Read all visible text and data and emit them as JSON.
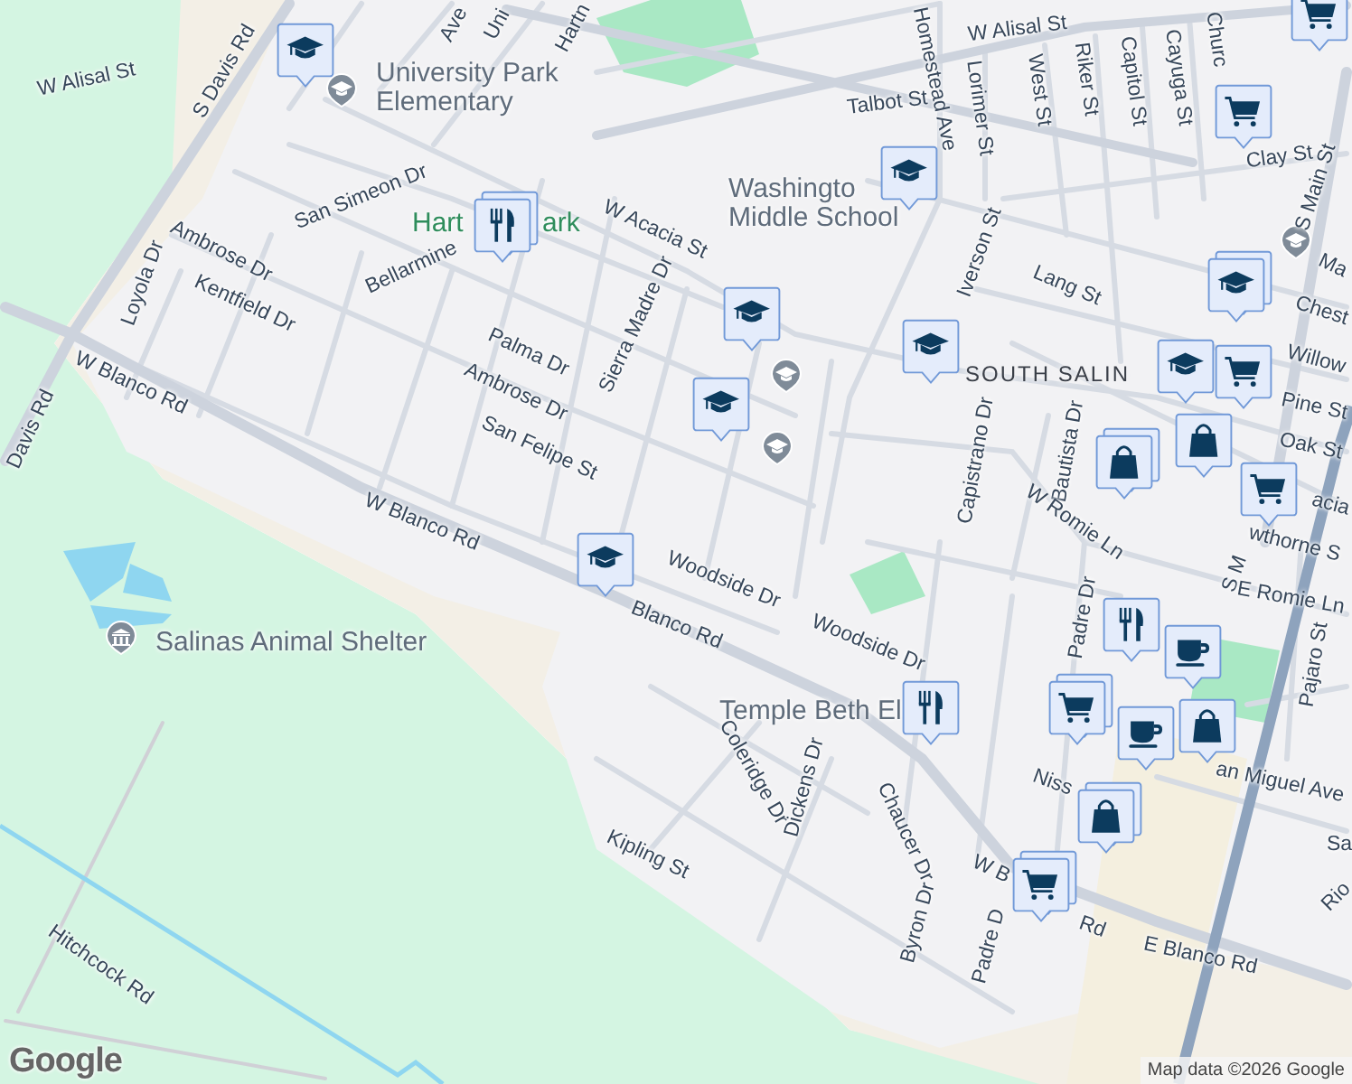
{
  "map": {
    "places": [
      {
        "kind": "school",
        "lines": [
          "University Park",
          "Elementary"
        ]
      },
      {
        "kind": "park",
        "lines": [
          "Hart"
        ]
      },
      {
        "kind": "park",
        "lines": [
          "ark"
        ]
      },
      {
        "kind": "school",
        "lines": [
          "Washingto",
          "Middle School"
        ]
      },
      {
        "kind": "district",
        "lines": [
          "SOUTH SALIN"
        ]
      },
      {
        "kind": "shelter",
        "lines": [
          "Salinas Animal Shelter"
        ]
      },
      {
        "kind": "worship",
        "lines": [
          "Temple Beth El"
        ]
      }
    ],
    "streets": [
      {
        "name": "Ave"
      },
      {
        "name": "Uni"
      },
      {
        "name": "Hartn"
      },
      {
        "name": "S Davis Rd"
      },
      {
        "name": "Davis Rd"
      },
      {
        "name": "W Blanco Rd"
      },
      {
        "name": "W Blanco Rd"
      },
      {
        "name": "Blanco Rd"
      },
      {
        "name": "San Simeon Dr"
      },
      {
        "name": "Ambrose Dr"
      },
      {
        "name": "Loyola Dr"
      },
      {
        "name": "Kentfield Dr"
      },
      {
        "name": "Bellarmine"
      },
      {
        "name": "Palma Dr"
      },
      {
        "name": "Ambrose Dr"
      },
      {
        "name": "San Felipe St"
      },
      {
        "name": "Sierra Madre Dr"
      },
      {
        "name": "W Acacia St"
      },
      {
        "name": "W Alisal St"
      },
      {
        "name": "W Alisal St"
      },
      {
        "name": "Homestead Ave"
      },
      {
        "name": "Talbot St"
      },
      {
        "name": "Lorimer St"
      },
      {
        "name": "West St"
      },
      {
        "name": "Riker St"
      },
      {
        "name": "Capitol St"
      },
      {
        "name": "Cayuga St"
      },
      {
        "name": "Churc"
      },
      {
        "name": "Clay St"
      },
      {
        "name": "S Main St"
      },
      {
        "name": "Iverson St"
      },
      {
        "name": "Lang St"
      },
      {
        "name": "Ma"
      },
      {
        "name": "Chest"
      },
      {
        "name": "Willow"
      },
      {
        "name": "Pine St"
      },
      {
        "name": "Oak St"
      },
      {
        "name": "acia"
      },
      {
        "name": "wthorne S"
      },
      {
        "name": "Capistrano Dr"
      },
      {
        "name": "Bautista Dr"
      },
      {
        "name": "W Romie Ln"
      },
      {
        "name": "S M"
      },
      {
        "name": "E Romie Ln"
      },
      {
        "name": "Padre Dr"
      },
      {
        "name": "Pajaro St"
      },
      {
        "name": "an Miguel Ave"
      },
      {
        "name": "Niss"
      },
      {
        "name": "Sa"
      },
      {
        "name": "Rio"
      },
      {
        "name": "Woodside Dr"
      },
      {
        "name": "Woodside Dr"
      },
      {
        "name": "Coleridge Dr"
      },
      {
        "name": "Dickens Dr"
      },
      {
        "name": "Chaucer Dr"
      },
      {
        "name": "Byron Dr"
      },
      {
        "name": "Padre D"
      },
      {
        "name": "W B"
      },
      {
        "name": "Rd"
      },
      {
        "name": "E Blanco Rd"
      },
      {
        "name": "Kipling St"
      },
      {
        "name": "Hitchcock Rd"
      }
    ],
    "markers": [
      {
        "kind": "school",
        "stacked": false
      },
      {
        "kind": "restaurant",
        "stacked": true
      },
      {
        "kind": "school",
        "stacked": false
      },
      {
        "kind": "school",
        "stacked": false
      },
      {
        "kind": "school",
        "stacked": false
      },
      {
        "kind": "school",
        "stacked": false
      },
      {
        "kind": "school",
        "stacked": false
      },
      {
        "kind": "cart",
        "stacked": false
      },
      {
        "kind": "cart",
        "stacked": false
      },
      {
        "kind": "school",
        "stacked": true
      },
      {
        "kind": "cart",
        "stacked": false
      },
      {
        "kind": "school",
        "stacked": false
      },
      {
        "kind": "bag",
        "stacked": true
      },
      {
        "kind": "bag",
        "stacked": false
      },
      {
        "kind": "cart",
        "stacked": false
      },
      {
        "kind": "restaurant",
        "stacked": false
      },
      {
        "kind": "coffee",
        "stacked": false
      },
      {
        "kind": "cart",
        "stacked": true
      },
      {
        "kind": "coffee",
        "stacked": false
      },
      {
        "kind": "bag",
        "stacked": false
      },
      {
        "kind": "restaurant",
        "stacked": false
      },
      {
        "kind": "bag",
        "stacked": true
      },
      {
        "kind": "cart",
        "stacked": true
      }
    ]
  },
  "logo": "Google",
  "attribution": "Map data ©2026 Google"
}
